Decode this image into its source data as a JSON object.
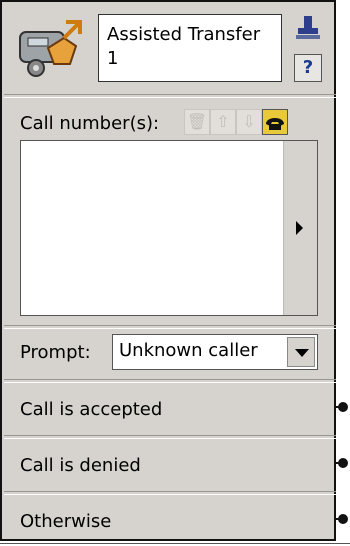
{
  "node": {
    "title": "Assisted Transfer 1",
    "help_label": "?"
  },
  "call_numbers": {
    "label": "Call number(s):",
    "items": []
  },
  "prompt": {
    "label": "Prompt:",
    "selected": "Unknown caller"
  },
  "outcomes": [
    {
      "label": "Call is accepted"
    },
    {
      "label": "Call is denied"
    },
    {
      "label": "Otherwise"
    }
  ],
  "colors": {
    "panel": "#d6d3ce",
    "accent": "#e8c93a",
    "border": "#111111"
  }
}
